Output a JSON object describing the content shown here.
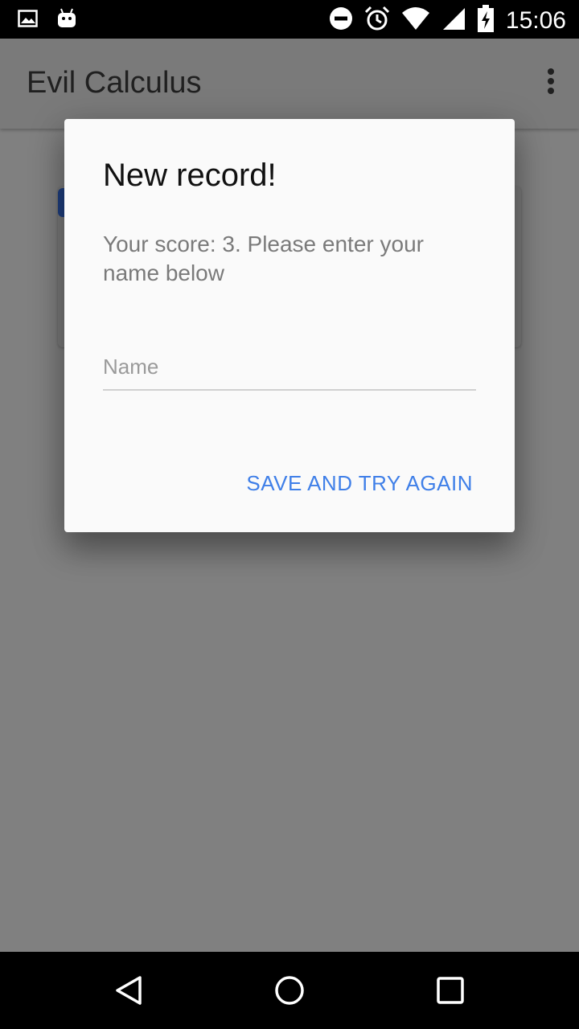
{
  "status_bar": {
    "time": "15:06",
    "icons": [
      "image-notification-icon",
      "android-notification-icon",
      "do-not-disturb-icon",
      "alarm-icon",
      "wifi-icon",
      "signal-icon",
      "battery-charging-icon"
    ]
  },
  "app_bar": {
    "title": "Evil Calculus",
    "overflow_icon": "more-vert-icon"
  },
  "dialog": {
    "title": "New record!",
    "message": "Your score: 3. Please enter your name below",
    "name_input": {
      "placeholder": "Name",
      "value": ""
    },
    "action_label": "SAVE AND TRY AGAIN"
  },
  "nav_bar": {
    "icons": [
      "back-icon",
      "home-icon",
      "recents-icon"
    ]
  },
  "colors": {
    "accent": "#3f7fe8",
    "scrim_background": "#808080",
    "dialog_background": "#fafafa"
  }
}
